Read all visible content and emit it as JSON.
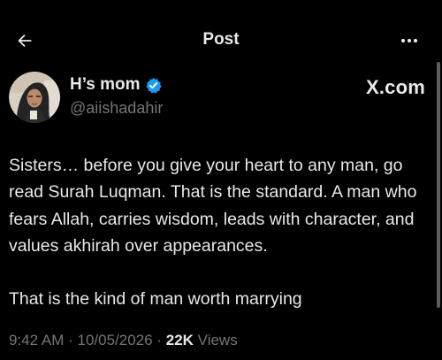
{
  "header": {
    "title": "Post",
    "back_icon": "arrow-left-icon",
    "more_icon": "more-horizontal-icon"
  },
  "author": {
    "display_name": "H’s mom",
    "handle": "@aiishadahir",
    "verified": true,
    "verified_color": "#1d9bf0",
    "avatar": "avatar-photo-hijab-icon"
  },
  "source_label": "X.com",
  "tweet": {
    "paragraphs": [
      "Sisters… before you give your heart to any man, go read Surah Luqman. That is the standard. A man who fears Allah, carries wisdom, leads with character, and values akhirah over appearances.",
      "That is the kind of man worth marrying"
    ]
  },
  "meta": {
    "time": "9:42 AM",
    "date": "10/05/2026",
    "separator": "·",
    "views_count": "22K",
    "views_label": "Views"
  },
  "colors": {
    "background": "#000000",
    "text_primary": "#e7e9ea",
    "text_secondary": "#71767b",
    "accent": "#1d9bf0"
  }
}
